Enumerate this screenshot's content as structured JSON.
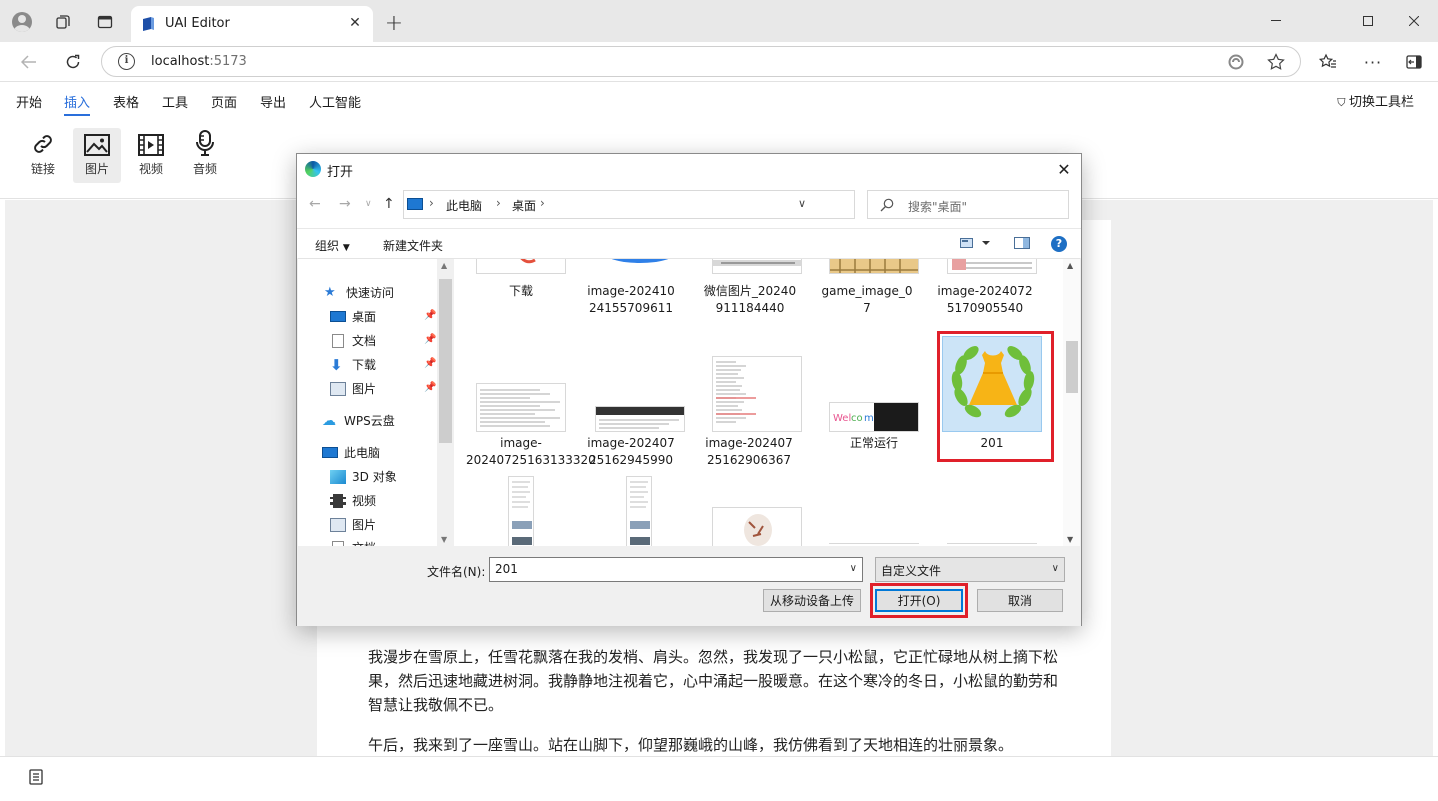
{
  "browser": {
    "tab_title": "UAI Editor",
    "url_host": "localhost",
    "url_port": ":5173"
  },
  "menu": {
    "items": [
      "开始",
      "插入",
      "表格",
      "工具",
      "页面",
      "导出",
      "人工智能"
    ],
    "active": "插入",
    "switch_toolbar": "切换工具栏"
  },
  "ribbon": {
    "buttons": [
      "链接",
      "图片",
      "视频",
      "音频"
    ],
    "selected": "图片"
  },
  "document": {
    "paragraphs": [
      "我漫步在雪原上，任雪花飘落在我的发梢、肩头。忽然，我发现了一只小松鼠，它正忙碌地从树上摘下松果，然后迅速地藏进树洞。我静静地注视着它，心中涌起一股暖意。在这个寒冷的冬日，小松鼠的勤劳和智慧让我敬佩不已。",
      "午后，我来到了一座雪山。站在山脚下，仰望那巍峨的山峰，我仿佛看到了天地相连的壮丽景象。"
    ]
  },
  "dialog": {
    "title": "打开",
    "path": [
      "此电脑",
      "桌面"
    ],
    "search_placeholder": "搜索\"桌面\"",
    "organize": "组织",
    "new_folder": "新建文件夹",
    "nav_items": {
      "quick_access": "快速访问",
      "desktop": "桌面",
      "documents": "文档",
      "downloads": "下载",
      "pictures": "图片",
      "wps": "WPS云盘",
      "this_pc": "此电脑",
      "objects3d": "3D 对象",
      "videos": "视频",
      "pictures2": "图片",
      "documents2": "文档"
    },
    "files_row1": [
      "下载",
      "image-20241024155709611",
      "微信图片_20240911184440",
      "game_image_07",
      "image-20240725170905540"
    ],
    "files_row2": [
      "image-20240725163133320",
      "image-20240725162945990",
      "image-20240725162906367",
      "正常运行",
      "201"
    ],
    "selected_file": "201",
    "filename_label": "文件名(N):",
    "filename_value": "201",
    "filetype": "自定义文件",
    "upload_mobile": "从移动设备上传",
    "open_button": "打开(O)",
    "cancel_button": "取消"
  }
}
